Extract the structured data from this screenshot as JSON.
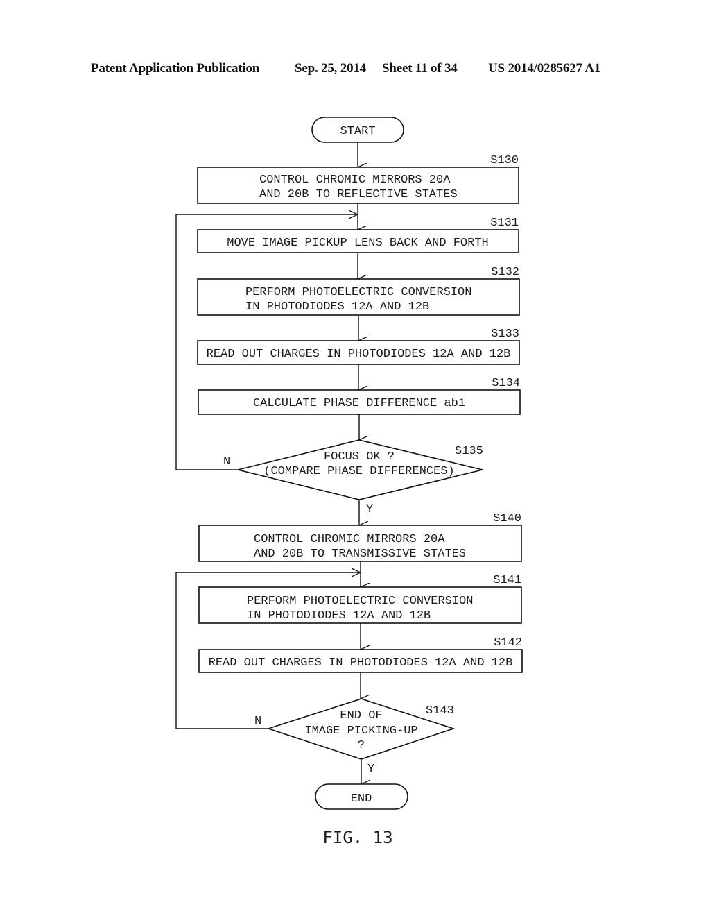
{
  "header": {
    "publication": "Patent Application Publication",
    "date": "Sep. 25, 2014",
    "sheet": "Sheet 11 of 34",
    "number": "US 2014/0285627 A1"
  },
  "flowchart": {
    "start": "START",
    "end": "END",
    "steps": [
      {
        "id": "S130",
        "lines": [
          "CONTROL CHROMIC MIRRORS 20A",
          "AND 20B TO REFLECTIVE STATES"
        ]
      },
      {
        "id": "S131",
        "lines": [
          "MOVE IMAGE PICKUP LENS BACK AND FORTH"
        ]
      },
      {
        "id": "S132",
        "lines": [
          "PERFORM PHOTOELECTRIC CONVERSION",
          "IN PHOTODIODES 12A AND 12B"
        ]
      },
      {
        "id": "S133",
        "lines": [
          "READ OUT CHARGES IN PHOTODIODES 12A AND 12B"
        ]
      },
      {
        "id": "S134",
        "lines": [
          "CALCULATE PHASE DIFFERENCE ab1"
        ]
      },
      {
        "id": "S140",
        "lines": [
          "CONTROL CHROMIC MIRRORS 20A",
          "AND 20B TO TRANSMISSIVE STATES"
        ]
      },
      {
        "id": "S141",
        "lines": [
          "PERFORM PHOTOELECTRIC CONVERSION",
          "IN PHOTODIODES 12A AND 12B"
        ]
      },
      {
        "id": "S142",
        "lines": [
          "READ OUT CHARGES IN PHOTODIODES 12A AND 12B"
        ]
      }
    ],
    "decisions": [
      {
        "id": "S135",
        "lines": [
          "FOCUS OK ?",
          "(COMPARE PHASE DIFFERENCES)"
        ],
        "no_label": "N",
        "yes_label": "Y"
      },
      {
        "id": "S143",
        "lines": [
          "END OF",
          "IMAGE PICKING-UP",
          "?"
        ],
        "no_label": "N",
        "yes_label": "Y"
      }
    ]
  },
  "figure_label": "FIG. 13"
}
